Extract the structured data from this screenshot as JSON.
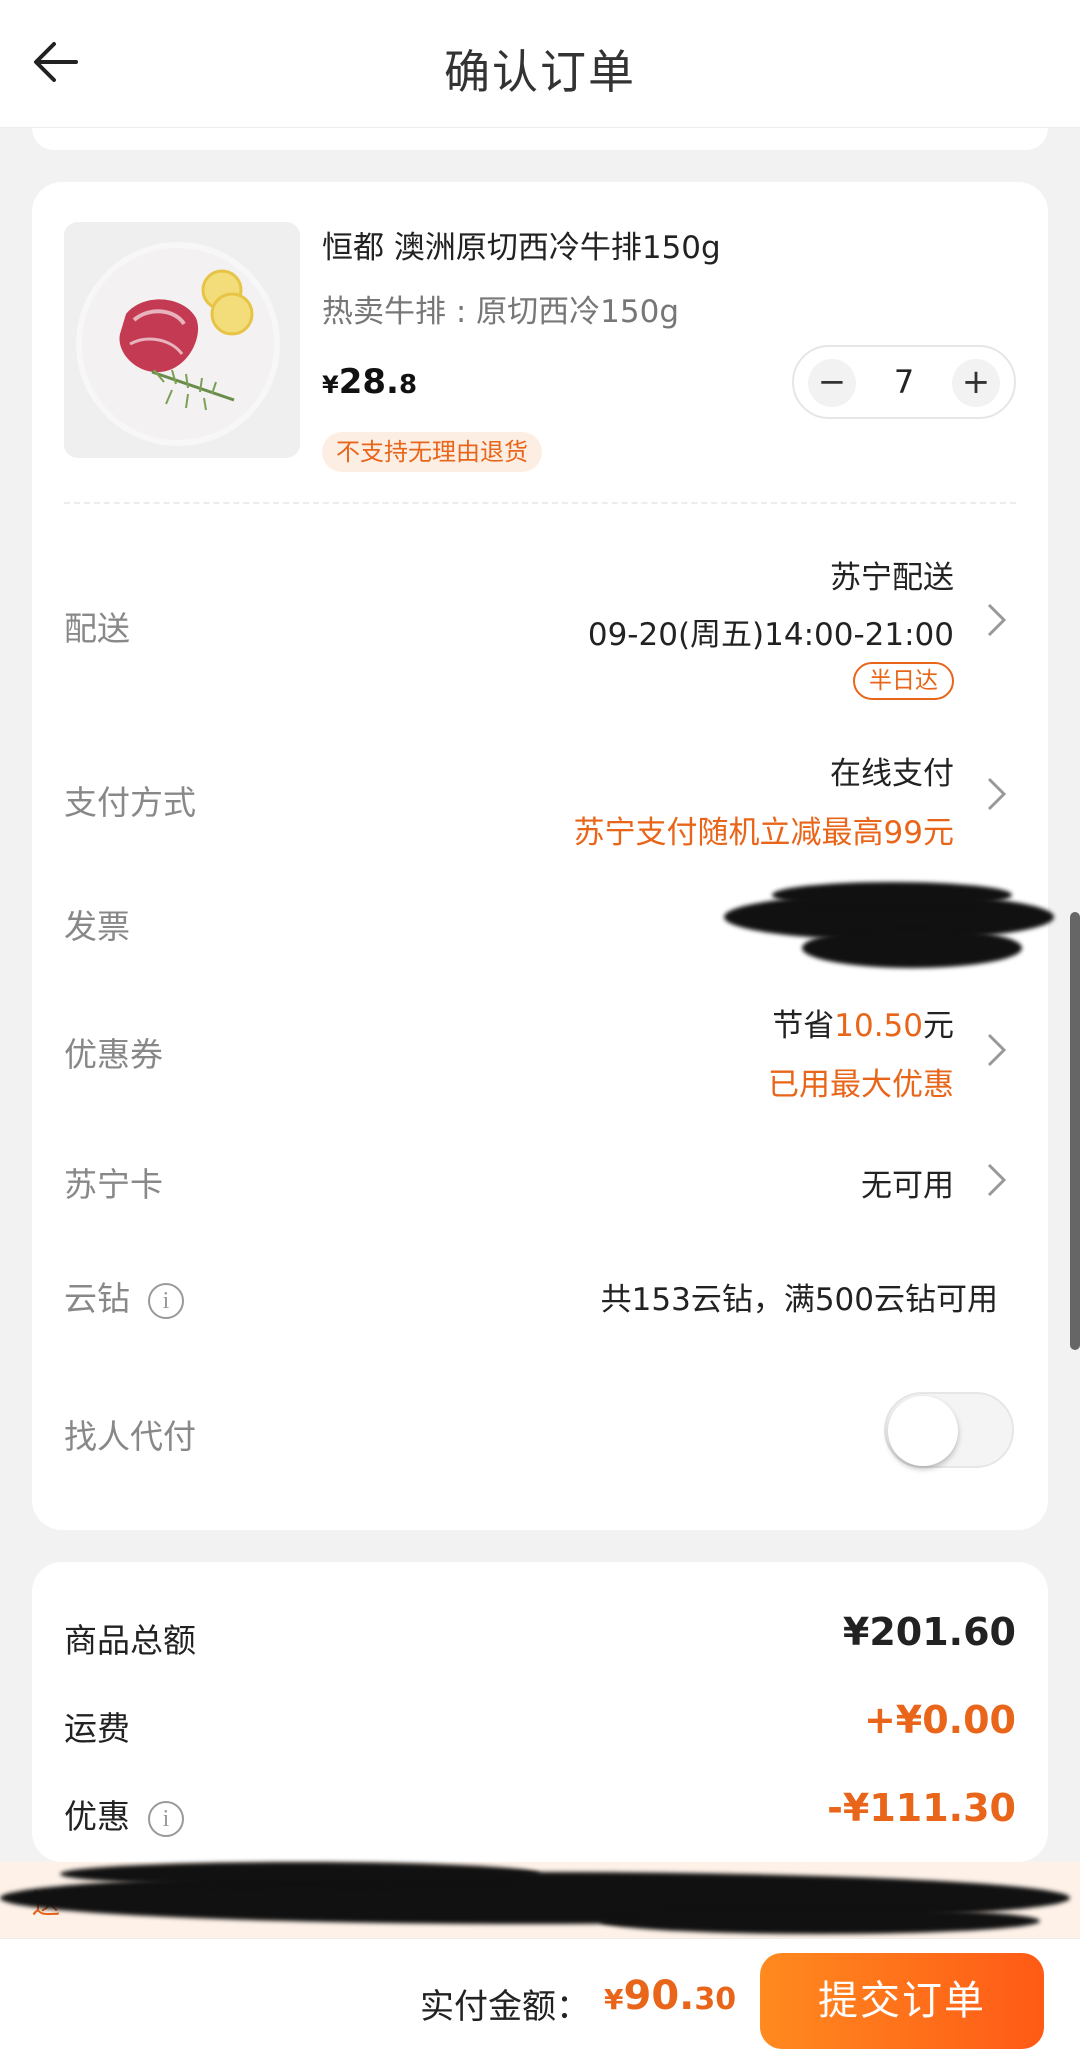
{
  "header": {
    "title": "确认订单",
    "back_icon": "arrow-left-icon"
  },
  "product": {
    "name": "恒都 澳洲原切西冷牛排150g",
    "spec": "热卖牛排 : 原切西冷150g",
    "price_symbol": "¥",
    "price_int": "28.",
    "price_dec": "8",
    "return_tag": "不支持无理由退货",
    "quantity": "7",
    "minus": "−",
    "plus": "+"
  },
  "rows": {
    "delivery": {
      "label": "配送",
      "carrier": "苏宁配送",
      "time": "09-20(周五)14:00-21:00",
      "badge": "半日达"
    },
    "payment": {
      "label": "支付方式",
      "method": "在线支付",
      "promo": "苏宁支付随机立减最高99元"
    },
    "invoice": {
      "label": "发票"
    },
    "coupon": {
      "label": "优惠券",
      "save_prefix": "节省",
      "save_amount": "10.50",
      "save_suffix": "元",
      "note": "已用最大优惠"
    },
    "card": {
      "label": "苏宁卡",
      "value": "无可用"
    },
    "yunzuan": {
      "label": "云钻",
      "info": "i",
      "value": "共153云钻，满500云钻可用"
    },
    "pay_for_me": {
      "label": "找人代付",
      "enabled": false
    }
  },
  "totals": {
    "goods_label": "商品总额",
    "goods_value": "¥201.60",
    "shipping_label": "运费",
    "shipping_value": "+¥0.00",
    "discount_label": "优惠",
    "discount_info": "i",
    "discount_value": "-¥111.30"
  },
  "promo_strip": {
    "text": "送"
  },
  "bottom": {
    "pay_label": "实付金额：",
    "pay_symbol": "¥",
    "pay_int": "90.",
    "pay_dec": "30",
    "submit_label": "提交订单"
  },
  "colors": {
    "accent": "#e8651a",
    "button_start": "#ff8a1f",
    "button_end": "#ff5a16"
  }
}
